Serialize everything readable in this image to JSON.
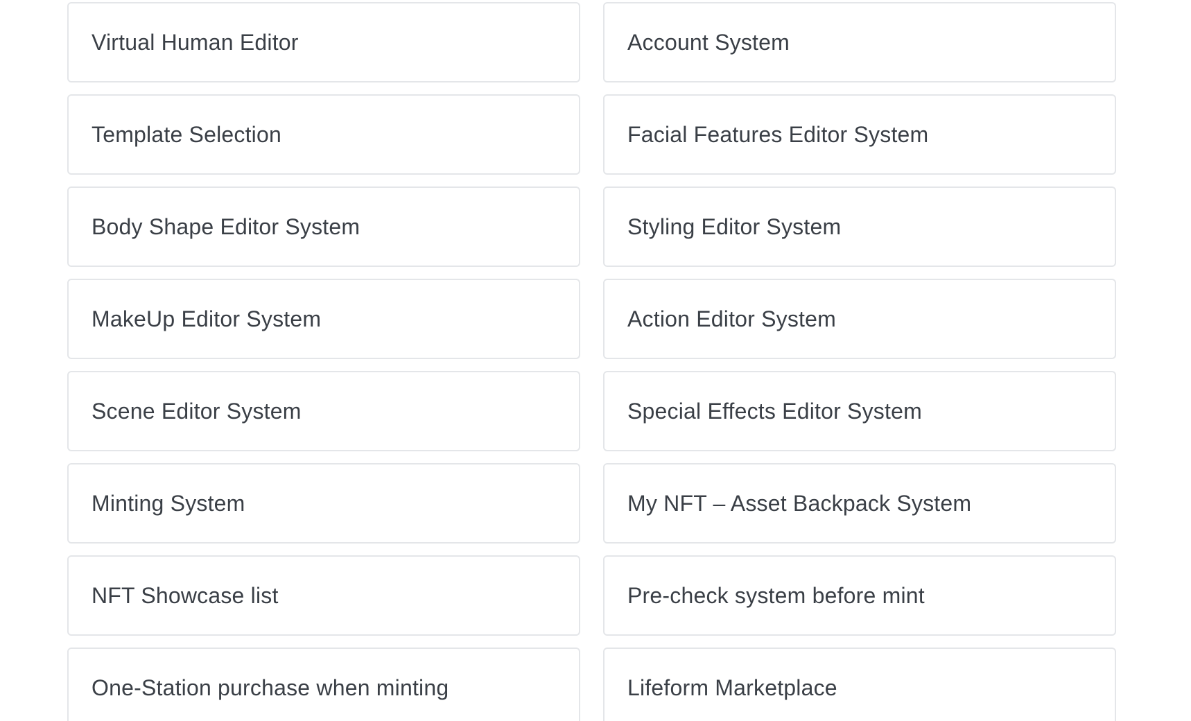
{
  "features": {
    "items": [
      {
        "label": "Virtual Human Editor"
      },
      {
        "label": "Account System"
      },
      {
        "label": "Template Selection"
      },
      {
        "label": "Facial Features Editor System"
      },
      {
        "label": "Body Shape Editor System"
      },
      {
        "label": "Styling Editor System"
      },
      {
        "label": "MakeUp Editor System"
      },
      {
        "label": "Action Editor System"
      },
      {
        "label": "Scene Editor System"
      },
      {
        "label": "Special Effects Editor System"
      },
      {
        "label": "Minting System"
      },
      {
        "label": "My NFT – Asset Backpack System"
      },
      {
        "label": "NFT Showcase list"
      },
      {
        "label": "Pre-check system before mint"
      },
      {
        "label": "One-Station purchase when minting"
      },
      {
        "label": "Lifeform Marketplace"
      }
    ]
  }
}
